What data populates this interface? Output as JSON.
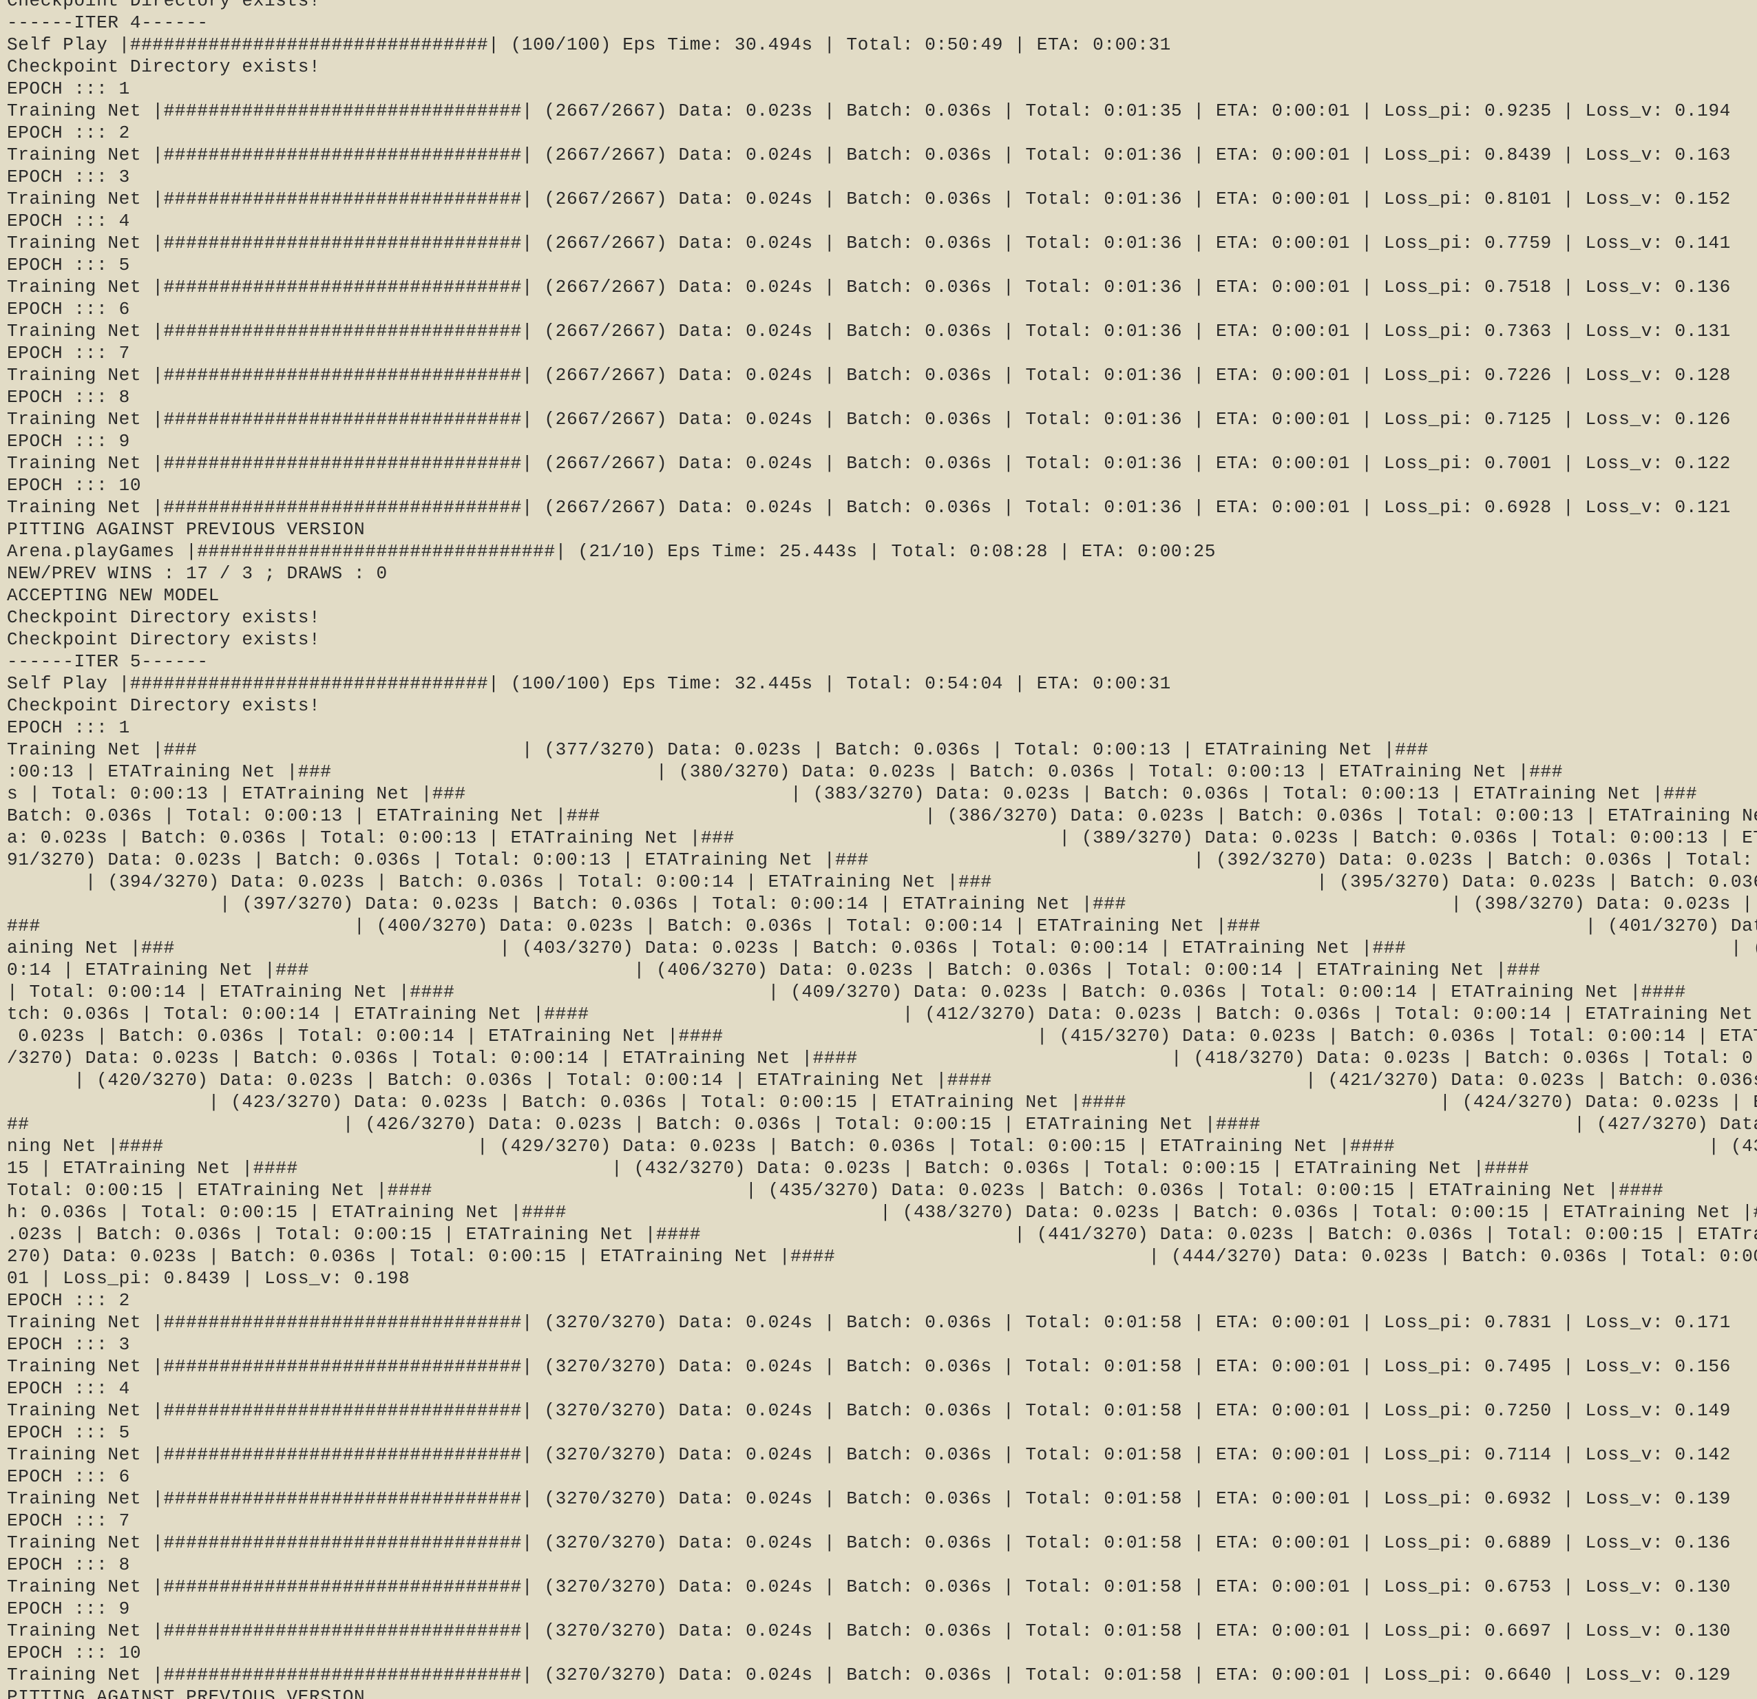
{
  "terminal": {
    "lines": [
      "Checkpoint Directory exists!",
      "------ITER 4------",
      "Self Play |################################| (100/100) Eps Time: 30.494s | Total: 0:50:49 | ETA: 0:00:31",
      "Checkpoint Directory exists!",
      "EPOCH ::: 1",
      "Training Net |################################| (2667/2667) Data: 0.023s | Batch: 0.036s | Total: 0:01:35 | ETA: 0:00:01 | Loss_pi: 0.9235 | Loss_v: 0.194",
      "EPOCH ::: 2",
      "Training Net |################################| (2667/2667) Data: 0.024s | Batch: 0.036s | Total: 0:01:36 | ETA: 0:00:01 | Loss_pi: 0.8439 | Loss_v: 0.163",
      "EPOCH ::: 3",
      "Training Net |################################| (2667/2667) Data: 0.024s | Batch: 0.036s | Total: 0:01:36 | ETA: 0:00:01 | Loss_pi: 0.8101 | Loss_v: 0.152",
      "EPOCH ::: 4",
      "Training Net |################################| (2667/2667) Data: 0.024s | Batch: 0.036s | Total: 0:01:36 | ETA: 0:00:01 | Loss_pi: 0.7759 | Loss_v: 0.141",
      "EPOCH ::: 5",
      "Training Net |################################| (2667/2667) Data: 0.024s | Batch: 0.036s | Total: 0:01:36 | ETA: 0:00:01 | Loss_pi: 0.7518 | Loss_v: 0.136",
      "EPOCH ::: 6",
      "Training Net |################################| (2667/2667) Data: 0.024s | Batch: 0.036s | Total: 0:01:36 | ETA: 0:00:01 | Loss_pi: 0.7363 | Loss_v: 0.131",
      "EPOCH ::: 7",
      "Training Net |################################| (2667/2667) Data: 0.024s | Batch: 0.036s | Total: 0:01:36 | ETA: 0:00:01 | Loss_pi: 0.7226 | Loss_v: 0.128",
      "EPOCH ::: 8",
      "Training Net |################################| (2667/2667) Data: 0.024s | Batch: 0.036s | Total: 0:01:36 | ETA: 0:00:01 | Loss_pi: 0.7125 | Loss_v: 0.126",
      "EPOCH ::: 9",
      "Training Net |################################| (2667/2667) Data: 0.024s | Batch: 0.036s | Total: 0:01:36 | ETA: 0:00:01 | Loss_pi: 0.7001 | Loss_v: 0.122",
      "EPOCH ::: 10",
      "Training Net |################################| (2667/2667) Data: 0.024s | Batch: 0.036s | Total: 0:01:36 | ETA: 0:00:01 | Loss_pi: 0.6928 | Loss_v: 0.121",
      "PITTING AGAINST PREVIOUS VERSION",
      "Arena.playGames |################################| (21/10) Eps Time: 25.443s | Total: 0:08:28 | ETA: 0:00:25",
      "NEW/PREV WINS : 17 / 3 ; DRAWS : 0",
      "ACCEPTING NEW MODEL",
      "Checkpoint Directory exists!",
      "Checkpoint Directory exists!",
      "------ITER 5------",
      "Self Play |################################| (100/100) Eps Time: 32.445s | Total: 0:54:04 | ETA: 0:00:31",
      "Checkpoint Directory exists!",
      "EPOCH ::: 1",
      "Training Net |###                             | (377/3270) Data: 0.023s | Batch: 0.036s | Total: 0:00:13 | ETATraining Net |###                             | (",
      ":00:13 | ETATraining Net |###                             | (380/3270) Data: 0.023s | Batch: 0.036s | Total: 0:00:13 | ETATraining Net |###",
      "s | Total: 0:00:13 | ETATraining Net |###                             | (383/3270) Data: 0.023s | Batch: 0.036s | Total: 0:00:13 | ETATraining Net |###",
      "Batch: 0.036s | Total: 0:00:13 | ETATraining Net |###                             | (386/3270) Data: 0.023s | Batch: 0.036s | Total: 0:00:13 | ETATraining Net",
      "a: 0.023s | Batch: 0.036s | Total: 0:00:13 | ETATraining Net |###                             | (389/3270) Data: 0.023s | Batch: 0.036s | Total: 0:00:13 | ETAT",
      "91/3270) Data: 0.023s | Batch: 0.036s | Total: 0:00:13 | ETATraining Net |###                             | (392/3270) Data: 0.023s | Batch: 0.036s | Total: 0:",
      "       | (394/3270) Data: 0.023s | Batch: 0.036s | Total: 0:00:14 | ETATraining Net |###                             | (395/3270) Data: 0.023s | Batch: 0.036s",
      "                   | (397/3270) Data: 0.023s | Batch: 0.036s | Total: 0:00:14 | ETATraining Net |###                             | (398/3270) Data: 0.023s | B",
      "###                            | (400/3270) Data: 0.023s | Batch: 0.036s | Total: 0:00:14 | ETATraining Net |###                             | (401/3270) Data",
      "aining Net |###                             | (403/3270) Data: 0.023s | Batch: 0.036s | Total: 0:00:14 | ETATraining Net |###                             | (40",
      "0:14 | ETATraining Net |###                             | (406/3270) Data: 0.023s | Batch: 0.036s | Total: 0:00:14 | ETATraining Net |###",
      "| Total: 0:00:14 | ETATraining Net |####                            | (409/3270) Data: 0.023s | Batch: 0.036s | Total: 0:00:14 | ETATraining Net |####",
      "tch: 0.036s | Total: 0:00:14 | ETATraining Net |####                            | (412/3270) Data: 0.023s | Batch: 0.036s | Total: 0:00:14 | ETATraining Net |#",
      " 0.023s | Batch: 0.036s | Total: 0:00:14 | ETATraining Net |####                            | (415/3270) Data: 0.023s | Batch: 0.036s | Total: 0:00:14 | ETATra",
      "/3270) Data: 0.023s | Batch: 0.036s | Total: 0:00:14 | ETATraining Net |####                            | (418/3270) Data: 0.023s | Batch: 0.036s | Total: 0:00",
      "      | (420/3270) Data: 0.023s | Batch: 0.036s | Total: 0:00:14 | ETATraining Net |####                            | (421/3270) Data: 0.023s | Batch: 0.036s |",
      "                  | (423/3270) Data: 0.023s | Batch: 0.036s | Total: 0:00:15 | ETATraining Net |####                            | (424/3270) Data: 0.023s | Bat",
      "##                            | (426/3270) Data: 0.023s | Batch: 0.036s | Total: 0:00:15 | ETATraining Net |####                            | (427/3270) Data:",
      "ning Net |####                            | (429/3270) Data: 0.023s | Batch: 0.036s | Total: 0:00:15 | ETATraining Net |####                            | (430/",
      "15 | ETATraining Net |####                            | (432/3270) Data: 0.023s | Batch: 0.036s | Total: 0:00:15 | ETATraining Net |####",
      "Total: 0:00:15 | ETATraining Net |####                            | (435/3270) Data: 0.023s | Batch: 0.036s | Total: 0:00:15 | ETATraining Net |####",
      "h: 0.036s | Total: 0:00:15 | ETATraining Net |####                            | (438/3270) Data: 0.023s | Batch: 0.036s | Total: 0:00:15 | ETATraining Net |###",
      ".023s | Batch: 0.036s | Total: 0:00:15 | ETATraining Net |####                            | (441/3270) Data: 0.023s | Batch: 0.036s | Total: 0:00:15 | ETATrain",
      "270) Data: 0.023s | Batch: 0.036s | Total: 0:00:15 | ETATraining Net |####                            | (444/3270) Data: 0.023s | Batch: 0.036s | Total: 0:00:1",
      "01 | Loss_pi: 0.8439 | Loss_v: 0.198",
      "EPOCH ::: 2",
      "Training Net |################################| (3270/3270) Data: 0.024s | Batch: 0.036s | Total: 0:01:58 | ETA: 0:00:01 | Loss_pi: 0.7831 | Loss_v: 0.171",
      "EPOCH ::: 3",
      "Training Net |################################| (3270/3270) Data: 0.024s | Batch: 0.036s | Total: 0:01:58 | ETA: 0:00:01 | Loss_pi: 0.7495 | Loss_v: 0.156",
      "EPOCH ::: 4",
      "Training Net |################################| (3270/3270) Data: 0.024s | Batch: 0.036s | Total: 0:01:58 | ETA: 0:00:01 | Loss_pi: 0.7250 | Loss_v: 0.149",
      "EPOCH ::: 5",
      "Training Net |################################| (3270/3270) Data: 0.024s | Batch: 0.036s | Total: 0:01:58 | ETA: 0:00:01 | Loss_pi: 0.7114 | Loss_v: 0.142",
      "EPOCH ::: 6",
      "Training Net |################################| (3270/3270) Data: 0.024s | Batch: 0.036s | Total: 0:01:58 | ETA: 0:00:01 | Loss_pi: 0.6932 | Loss_v: 0.139",
      "EPOCH ::: 7",
      "Training Net |################################| (3270/3270) Data: 0.024s | Batch: 0.036s | Total: 0:01:58 | ETA: 0:00:01 | Loss_pi: 0.6889 | Loss_v: 0.136",
      "EPOCH ::: 8",
      "Training Net |################################| (3270/3270) Data: 0.024s | Batch: 0.036s | Total: 0:01:58 | ETA: 0:00:01 | Loss_pi: 0.6753 | Loss_v: 0.130",
      "EPOCH ::: 9",
      "Training Net |################################| (3270/3270) Data: 0.024s | Batch: 0.036s | Total: 0:01:58 | ETA: 0:00:01 | Loss_pi: 0.6697 | Loss_v: 0.130",
      "EPOCH ::: 10",
      "Training Net |################################| (3270/3270) Data: 0.024s | Batch: 0.036s | Total: 0:01:58 | ETA: 0:00:01 | Loss_pi: 0.6640 | Loss_v: 0.129",
      "PITTING AGAINST PREVIOUS VERSION"
    ]
  }
}
